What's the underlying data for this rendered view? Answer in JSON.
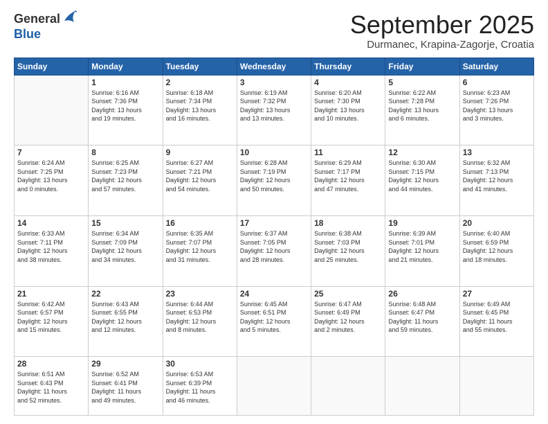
{
  "logo": {
    "general": "General",
    "blue": "Blue"
  },
  "header": {
    "month": "September 2025",
    "location": "Durmanec, Krapina-Zagorje, Croatia"
  },
  "weekdays": [
    "Sunday",
    "Monday",
    "Tuesday",
    "Wednesday",
    "Thursday",
    "Friday",
    "Saturday"
  ],
  "weeks": [
    [
      {
        "day": "",
        "info": ""
      },
      {
        "day": "1",
        "info": "Sunrise: 6:16 AM\nSunset: 7:36 PM\nDaylight: 13 hours\nand 19 minutes."
      },
      {
        "day": "2",
        "info": "Sunrise: 6:18 AM\nSunset: 7:34 PM\nDaylight: 13 hours\nand 16 minutes."
      },
      {
        "day": "3",
        "info": "Sunrise: 6:19 AM\nSunset: 7:32 PM\nDaylight: 13 hours\nand 13 minutes."
      },
      {
        "day": "4",
        "info": "Sunrise: 6:20 AM\nSunset: 7:30 PM\nDaylight: 13 hours\nand 10 minutes."
      },
      {
        "day": "5",
        "info": "Sunrise: 6:22 AM\nSunset: 7:28 PM\nDaylight: 13 hours\nand 6 minutes."
      },
      {
        "day": "6",
        "info": "Sunrise: 6:23 AM\nSunset: 7:26 PM\nDaylight: 13 hours\nand 3 minutes."
      }
    ],
    [
      {
        "day": "7",
        "info": "Sunrise: 6:24 AM\nSunset: 7:25 PM\nDaylight: 13 hours\nand 0 minutes."
      },
      {
        "day": "8",
        "info": "Sunrise: 6:25 AM\nSunset: 7:23 PM\nDaylight: 12 hours\nand 57 minutes."
      },
      {
        "day": "9",
        "info": "Sunrise: 6:27 AM\nSunset: 7:21 PM\nDaylight: 12 hours\nand 54 minutes."
      },
      {
        "day": "10",
        "info": "Sunrise: 6:28 AM\nSunset: 7:19 PM\nDaylight: 12 hours\nand 50 minutes."
      },
      {
        "day": "11",
        "info": "Sunrise: 6:29 AM\nSunset: 7:17 PM\nDaylight: 12 hours\nand 47 minutes."
      },
      {
        "day": "12",
        "info": "Sunrise: 6:30 AM\nSunset: 7:15 PM\nDaylight: 12 hours\nand 44 minutes."
      },
      {
        "day": "13",
        "info": "Sunrise: 6:32 AM\nSunset: 7:13 PM\nDaylight: 12 hours\nand 41 minutes."
      }
    ],
    [
      {
        "day": "14",
        "info": "Sunrise: 6:33 AM\nSunset: 7:11 PM\nDaylight: 12 hours\nand 38 minutes."
      },
      {
        "day": "15",
        "info": "Sunrise: 6:34 AM\nSunset: 7:09 PM\nDaylight: 12 hours\nand 34 minutes."
      },
      {
        "day": "16",
        "info": "Sunrise: 6:35 AM\nSunset: 7:07 PM\nDaylight: 12 hours\nand 31 minutes."
      },
      {
        "day": "17",
        "info": "Sunrise: 6:37 AM\nSunset: 7:05 PM\nDaylight: 12 hours\nand 28 minutes."
      },
      {
        "day": "18",
        "info": "Sunrise: 6:38 AM\nSunset: 7:03 PM\nDaylight: 12 hours\nand 25 minutes."
      },
      {
        "day": "19",
        "info": "Sunrise: 6:39 AM\nSunset: 7:01 PM\nDaylight: 12 hours\nand 21 minutes."
      },
      {
        "day": "20",
        "info": "Sunrise: 6:40 AM\nSunset: 6:59 PM\nDaylight: 12 hours\nand 18 minutes."
      }
    ],
    [
      {
        "day": "21",
        "info": "Sunrise: 6:42 AM\nSunset: 6:57 PM\nDaylight: 12 hours\nand 15 minutes."
      },
      {
        "day": "22",
        "info": "Sunrise: 6:43 AM\nSunset: 6:55 PM\nDaylight: 12 hours\nand 12 minutes."
      },
      {
        "day": "23",
        "info": "Sunrise: 6:44 AM\nSunset: 6:53 PM\nDaylight: 12 hours\nand 8 minutes."
      },
      {
        "day": "24",
        "info": "Sunrise: 6:45 AM\nSunset: 6:51 PM\nDaylight: 12 hours\nand 5 minutes."
      },
      {
        "day": "25",
        "info": "Sunrise: 6:47 AM\nSunset: 6:49 PM\nDaylight: 12 hours\nand 2 minutes."
      },
      {
        "day": "26",
        "info": "Sunrise: 6:48 AM\nSunset: 6:47 PM\nDaylight: 11 hours\nand 59 minutes."
      },
      {
        "day": "27",
        "info": "Sunrise: 6:49 AM\nSunset: 6:45 PM\nDaylight: 11 hours\nand 55 minutes."
      }
    ],
    [
      {
        "day": "28",
        "info": "Sunrise: 6:51 AM\nSunset: 6:43 PM\nDaylight: 11 hours\nand 52 minutes."
      },
      {
        "day": "29",
        "info": "Sunrise: 6:52 AM\nSunset: 6:41 PM\nDaylight: 11 hours\nand 49 minutes."
      },
      {
        "day": "30",
        "info": "Sunrise: 6:53 AM\nSunset: 6:39 PM\nDaylight: 11 hours\nand 46 minutes."
      },
      {
        "day": "",
        "info": ""
      },
      {
        "day": "",
        "info": ""
      },
      {
        "day": "",
        "info": ""
      },
      {
        "day": "",
        "info": ""
      }
    ]
  ]
}
